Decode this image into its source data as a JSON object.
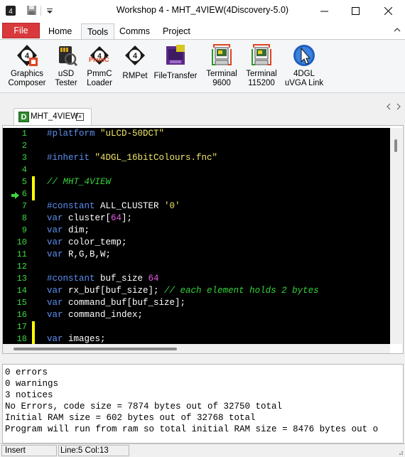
{
  "window": {
    "title": "Workshop 4 - MHT_4VIEW(4Discovery-5.0)"
  },
  "ribbon_tabs": [
    {
      "label": "File"
    },
    {
      "label": "Home"
    },
    {
      "label": "Tools"
    },
    {
      "label": "Comms"
    },
    {
      "label": "Project"
    }
  ],
  "ribbon_buttons": [
    {
      "line1": "Graphics",
      "line2": "Composer",
      "icon": "graphics-composer-icon"
    },
    {
      "line1": "uSD",
      "line2": "Tester",
      "icon": "usd-tester-icon"
    },
    {
      "line1": "PmmC",
      "line2": "Loader",
      "icon": "pmmc-loader-icon"
    },
    {
      "line1": "RMPet",
      "line2": "",
      "icon": "rmpet-icon"
    },
    {
      "line1": "FileTransfer",
      "line2": "",
      "icon": "file-transfer-icon"
    },
    {
      "line1": "Terminal",
      "line2": "9600",
      "icon": "terminal-icon"
    },
    {
      "line1": "Terminal",
      "line2": "115200",
      "icon": "terminal-icon"
    },
    {
      "line1": "4DGL",
      "line2": "uVGA Link",
      "icon": "uvga-link-icon"
    }
  ],
  "pmmc_badge": "PmmC",
  "document_tab": {
    "icon_letter": "D",
    "label": "MHT_4VIEW",
    "close": "×"
  },
  "editor": {
    "line_numbers": [
      "1",
      "2",
      "3",
      "4",
      "5",
      "6",
      "7",
      "8",
      "9",
      "10",
      "11",
      "12",
      "13",
      "14",
      "15",
      "16",
      "17",
      "18"
    ],
    "lines": [
      [
        {
          "t": "#platform ",
          "c": "kw"
        },
        {
          "t": "\"uLCD-50DCT\"",
          "c": "str"
        }
      ],
      [],
      [
        {
          "t": "#inherit ",
          "c": "kw"
        },
        {
          "t": "\"4DGL_16bitColours.fnc\"",
          "c": "str"
        }
      ],
      [],
      [
        {
          "t": "// MHT_4VIEW",
          "c": "cm"
        }
      ],
      [],
      [
        {
          "t": "#constant ",
          "c": "kw"
        },
        {
          "t": "ALL_CLUSTER ",
          "c": ""
        },
        {
          "t": "'0'",
          "c": "str"
        }
      ],
      [
        {
          "t": "var ",
          "c": "kw"
        },
        {
          "t": "cluster[",
          "c": ""
        },
        {
          "t": "64",
          "c": "num"
        },
        {
          "t": "];",
          "c": ""
        }
      ],
      [
        {
          "t": "var ",
          "c": "kw"
        },
        {
          "t": "dim;",
          "c": ""
        }
      ],
      [
        {
          "t": "var ",
          "c": "kw"
        },
        {
          "t": "color_temp;",
          "c": ""
        }
      ],
      [
        {
          "t": "var ",
          "c": "kw"
        },
        {
          "t": "R,G,B,W;",
          "c": ""
        }
      ],
      [],
      [
        {
          "t": "#constant ",
          "c": "kw"
        },
        {
          "t": "buf_size ",
          "c": ""
        },
        {
          "t": "64",
          "c": "num"
        }
      ],
      [
        {
          "t": "var ",
          "c": "kw"
        },
        {
          "t": "rx_buf[buf_size]; ",
          "c": ""
        },
        {
          "t": "// each element holds 2 bytes",
          "c": "cm"
        }
      ],
      [
        {
          "t": "var ",
          "c": "kw"
        },
        {
          "t": "command_buf[buf_size];",
          "c": ""
        }
      ],
      [
        {
          "t": "var ",
          "c": "kw"
        },
        {
          "t": "command_index;",
          "c": ""
        }
      ],
      [],
      [
        {
          "t": "var ",
          "c": "kw"
        },
        {
          "t": "images;",
          "c": ""
        }
      ]
    ],
    "current_line": 6,
    "changed_lines": [
      5,
      6,
      17,
      18
    ]
  },
  "output": {
    "lines": [
      "0 errors",
      "0 warnings",
      "3 notices",
      "No Errors, code size = 7874 bytes out of 32750 total",
      "Initial RAM size = 602 bytes out of 32768 total",
      "Program will run from ram so total initial RAM size = 8476 bytes out o"
    ]
  },
  "status": {
    "mode": "Insert",
    "position": "Line:5 Col:13"
  },
  "colors": {
    "file_tab": "#d9393c",
    "line_number": "#3dd83d",
    "keyword": "#5d8ff0",
    "string": "#f0e66a",
    "number": "#e65be6",
    "comment": "#35d13a",
    "change_marker": "#ffff00"
  }
}
